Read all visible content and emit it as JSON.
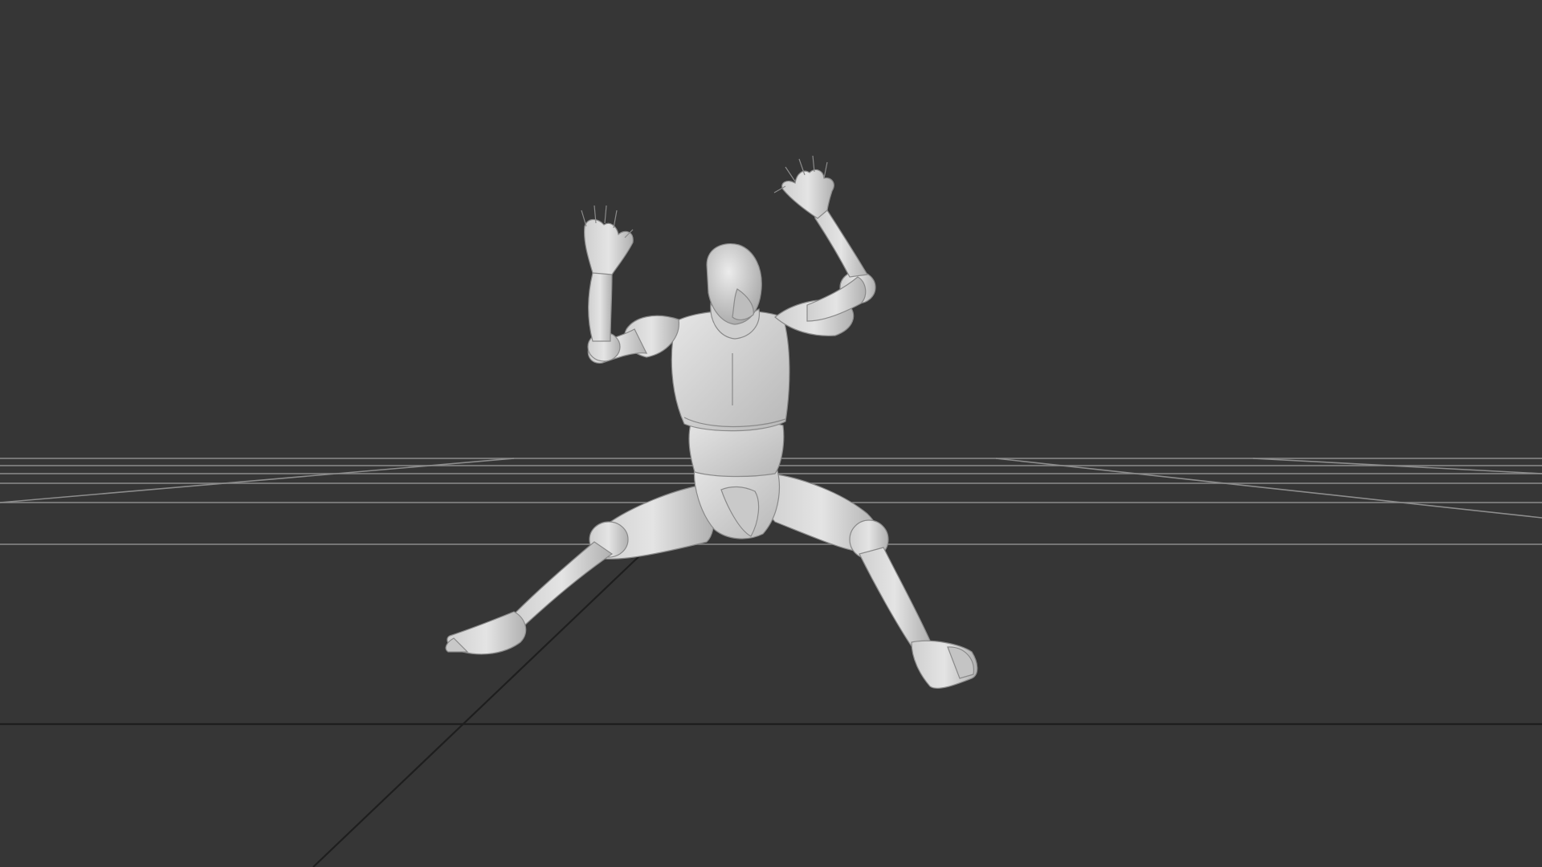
{
  "viewport": {
    "background_color": "#363636",
    "grid_line_color": "#8c8c8c",
    "horizon_axis_color": "#1e1e1e",
    "model_color": "#d9d9d9",
    "model_shadow_color": "#b5b5b5",
    "subject": "posed-mannequin"
  }
}
